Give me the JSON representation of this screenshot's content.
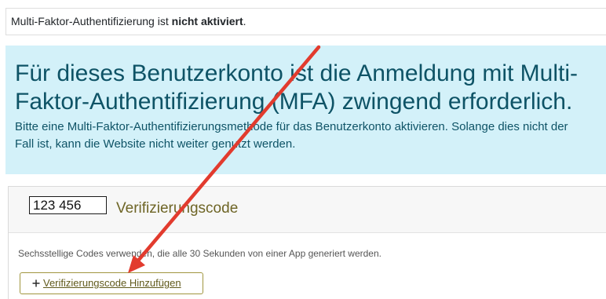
{
  "colors": {
    "alert_background": "#d3f1f9",
    "alert_text": "#0e5366",
    "card_title": "#6e6526",
    "button_border": "#a0963f",
    "button_text": "#615a1c",
    "annotation_arrow": "#e23b2e"
  },
  "status_notice": {
    "text": "Multi-Faktor-Authentifizierung ist",
    "status": "nicht aktiviert",
    "punctuation": "."
  },
  "mfa_required_alert": {
    "heading_lines": [
      "Für dieses Benutzerkonto ist die Anmeldung mit Multi-",
      "Faktor-Authentifizierung (MFA) zwingend erforderlich."
    ],
    "message_lines": [
      "Bitte eine Multi-Faktor-Authentifizierungsmethode für das Benutzerkonto aktivieren. Solange dies nicht der",
      "Fall ist, kann die Website nicht weiter genutzt werden."
    ]
  },
  "verification_method": {
    "code_sample": "123 456",
    "title": "Verifizierungscode",
    "description": "Sechsstellige Codes verwenden, die alle 30 Sekunden von einer App generiert werden.",
    "add_button": {
      "icon": "plus-icon",
      "label": "Verifizierungscode Hinzufügen"
    }
  }
}
